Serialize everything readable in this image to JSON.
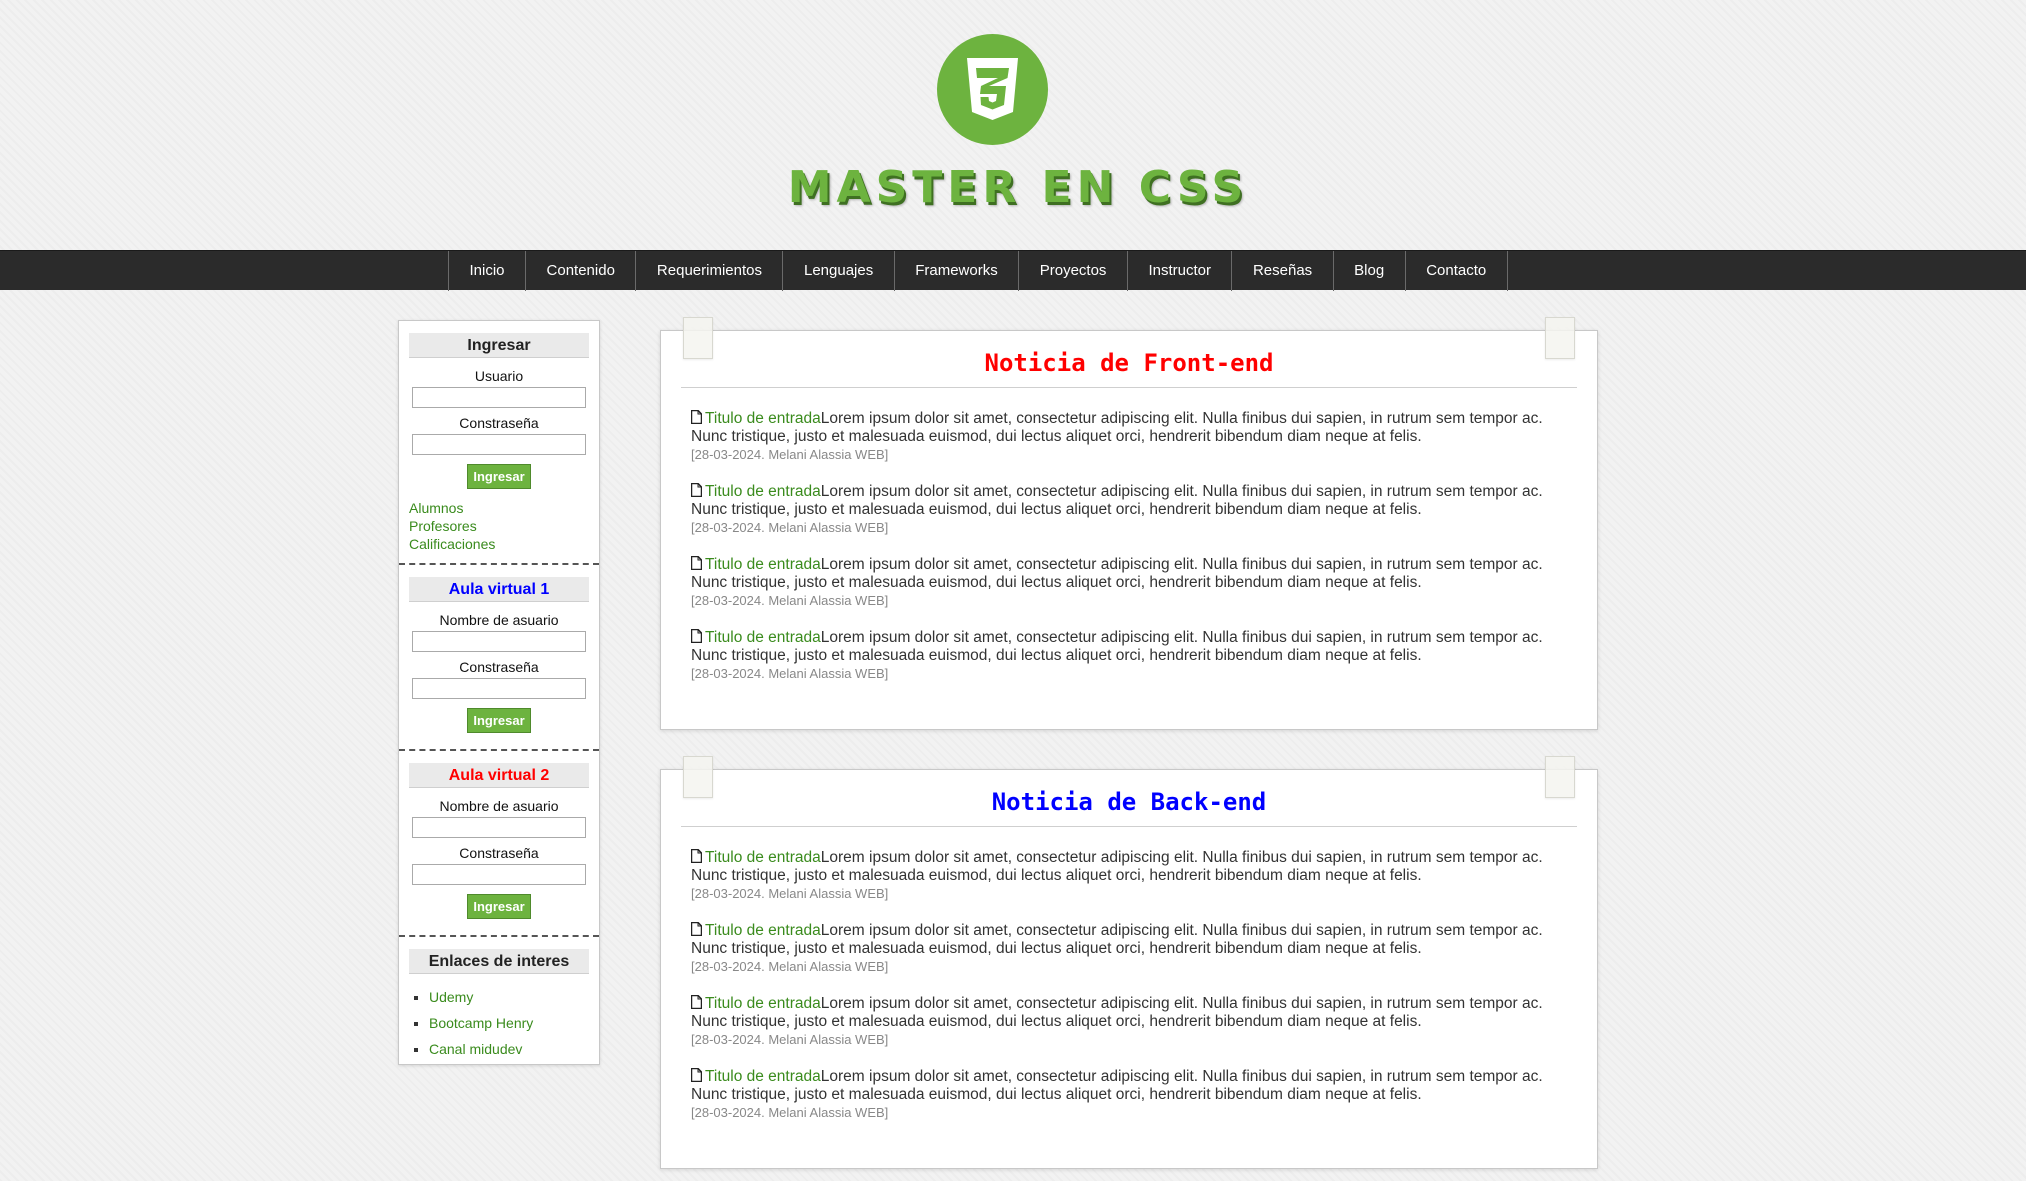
{
  "header": {
    "logo": "css3-shield-icon",
    "brand": "MASTER EN CSS"
  },
  "nav": {
    "items": [
      "Inicio",
      "Contenido",
      "Requerimientos",
      "Lenguajes",
      "Frameworks",
      "Proyectos",
      "Instructor",
      "Reseñas",
      "Blog",
      "Contacto"
    ]
  },
  "sidebar": {
    "login": {
      "title": "Ingresar",
      "user_label": "Usuario",
      "password_label": "Constraseña",
      "button": "Ingresar",
      "links": [
        "Alumnos",
        "Profesores",
        "Calificaciones"
      ]
    },
    "aula1": {
      "title": "Aula virtual 1",
      "user_label": "Nombre de asuario",
      "password_label": "Constraseña",
      "button": "Ingresar"
    },
    "aula2": {
      "title": "Aula virtual 2",
      "user_label": "Nombre de asuario",
      "password_label": "Constraseña",
      "button": "Ingresar"
    },
    "links_widget": {
      "title": "Enlaces de interes",
      "links": [
        "Udemy",
        "Bootcamp Henry",
        "Canal midudev"
      ]
    }
  },
  "news": [
    {
      "title": "Noticia de Front-end",
      "entries": [
        {
          "link": "Titulo de entrada",
          "text": "Lorem ipsum dolor sit amet, consectetur adipiscing elit. Nulla finibus dui sapien, in rutrum sem tempor ac. Nunc tristique, justo et malesuada euismod, dui lectus aliquet orci, hendrerit bibendum diam neque at felis.",
          "meta": "[28-03-2024. Melani Alassia WEB]"
        },
        {
          "link": "Titulo de entrada",
          "text": "Lorem ipsum dolor sit amet, consectetur adipiscing elit. Nulla finibus dui sapien, in rutrum sem tempor ac. Nunc tristique, justo et malesuada euismod, dui lectus aliquet orci, hendrerit bibendum diam neque at felis.",
          "meta": "[28-03-2024. Melani Alassia WEB]"
        },
        {
          "link": "Titulo de entrada",
          "text": "Lorem ipsum dolor sit amet, consectetur adipiscing elit. Nulla finibus dui sapien, in rutrum sem tempor ac. Nunc tristique, justo et malesuada euismod, dui lectus aliquet orci, hendrerit bibendum diam neque at felis.",
          "meta": "[28-03-2024. Melani Alassia WEB]"
        },
        {
          "link": "Titulo de entrada",
          "text": "Lorem ipsum dolor sit amet, consectetur adipiscing elit. Nulla finibus dui sapien, in rutrum sem tempor ac. Nunc tristique, justo et malesuada euismod, dui lectus aliquet orci, hendrerit bibendum diam neque at felis.",
          "meta": "[28-03-2024. Melani Alassia WEB]"
        }
      ]
    },
    {
      "title": "Noticia de Back-end",
      "entries": [
        {
          "link": "Titulo de entrada",
          "text": "Lorem ipsum dolor sit amet, consectetur adipiscing elit. Nulla finibus dui sapien, in rutrum sem tempor ac. Nunc tristique, justo et malesuada euismod, dui lectus aliquet orci, hendrerit bibendum diam neque at felis.",
          "meta": "[28-03-2024. Melani Alassia WEB]"
        },
        {
          "link": "Titulo de entrada",
          "text": "Lorem ipsum dolor sit amet, consectetur adipiscing elit. Nulla finibus dui sapien, in rutrum sem tempor ac. Nunc tristique, justo et malesuada euismod, dui lectus aliquet orci, hendrerit bibendum diam neque at felis.",
          "meta": "[28-03-2024. Melani Alassia WEB]"
        },
        {
          "link": "Titulo de entrada",
          "text": "Lorem ipsum dolor sit amet, consectetur adipiscing elit. Nulla finibus dui sapien, in rutrum sem tempor ac. Nunc tristique, justo et malesuada euismod, dui lectus aliquet orci, hendrerit bibendum diam neque at felis.",
          "meta": "[28-03-2024. Melani Alassia WEB]"
        },
        {
          "link": "Titulo de entrada",
          "text": "Lorem ipsum dolor sit amet, consectetur adipiscing elit. Nulla finibus dui sapien, in rutrum sem tempor ac. Nunc tristique, justo et malesuada euismod, dui lectus aliquet orci, hendrerit bibendum diam neque at felis.",
          "meta": "[28-03-2024. Melani Alassia WEB]"
        }
      ]
    }
  ],
  "colors": {
    "brand_green": "#6db33f",
    "link_green": "#3a8b1d",
    "nav_bg": "#2b2b2b",
    "front_title": "#ff0000",
    "back_title": "#0000ff"
  }
}
